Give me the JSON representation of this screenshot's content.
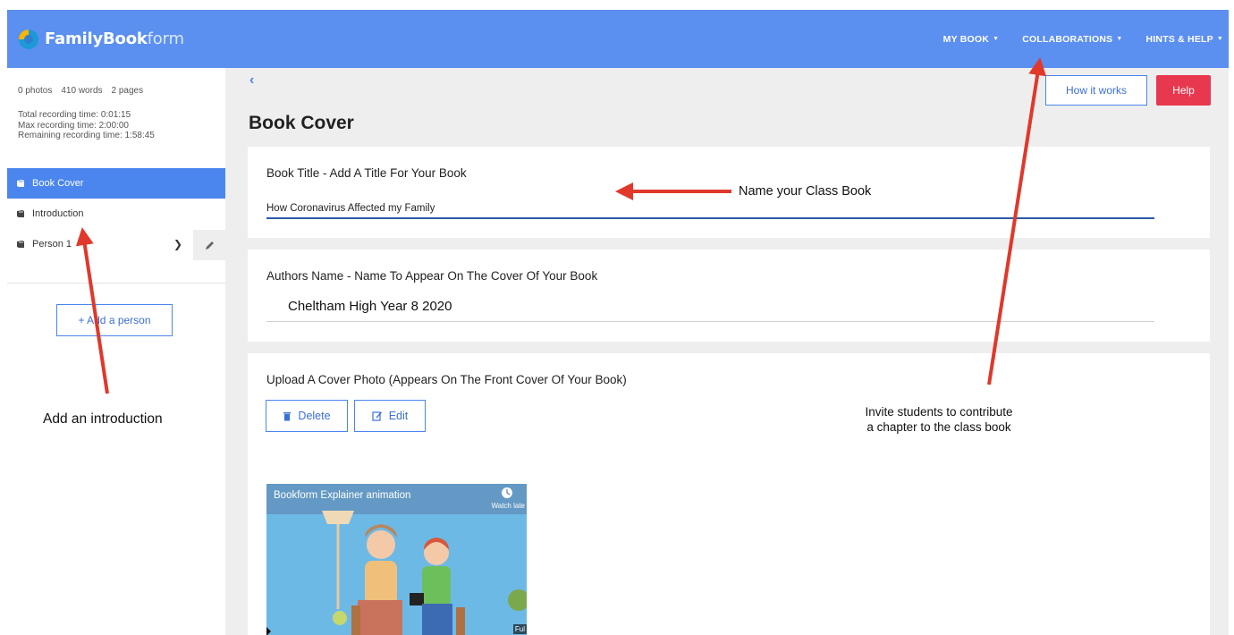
{
  "app": {
    "logo_text_bold": "FamilyBook",
    "logo_text_light": "form"
  },
  "nav": {
    "items": [
      {
        "label": "MY BOOK"
      },
      {
        "label": "COLLABORATIONS"
      },
      {
        "label": "HINTS & HELP"
      }
    ]
  },
  "sidebar": {
    "stats": {
      "photos": "0 photos",
      "words": "410 words",
      "pages": "2 pages"
    },
    "recording": {
      "total": "Total recording time: 0:01:15",
      "max": "Max recording time: 2:00:00",
      "remaining": "Remaining recording time: 1:58:45"
    },
    "items": [
      {
        "label": "Book Cover",
        "active": true
      },
      {
        "label": "Introduction",
        "active": false
      },
      {
        "label": "Person 1",
        "active": false
      }
    ],
    "add_person_label": "+ Add a person"
  },
  "main": {
    "back_icon": "chevron-left-icon",
    "title": "Book Cover",
    "how_it_works_label": "How it works",
    "help_label": "Help",
    "book_title": {
      "label": "Book Title - Add A Title For Your Book",
      "value": "How Coronavirus Affected my Family"
    },
    "authors_name": {
      "label": "Authors Name - Name To Appear On The Cover Of Your Book",
      "value": "Cheltham High Year 8 2020"
    },
    "cover_photo": {
      "label": "Upload A Cover Photo (Appears On The Front Cover Of Your Book)",
      "delete_label": "Delete",
      "edit_label": "Edit",
      "video_title": "Bookform Explainer animation",
      "watch_later": "Watch late",
      "full_label": "Ful"
    }
  },
  "annotations": {
    "name_book": "Name your Class Book",
    "add_intro": "Add an introduction",
    "invite_line1": "Invite students to contribute",
    "invite_line2": "a chapter to the class book"
  },
  "colors": {
    "topbar": "#5b8ff0",
    "active_item": "#4a86ee",
    "help_button": "#e8384f",
    "arrow": "#e0382b"
  }
}
